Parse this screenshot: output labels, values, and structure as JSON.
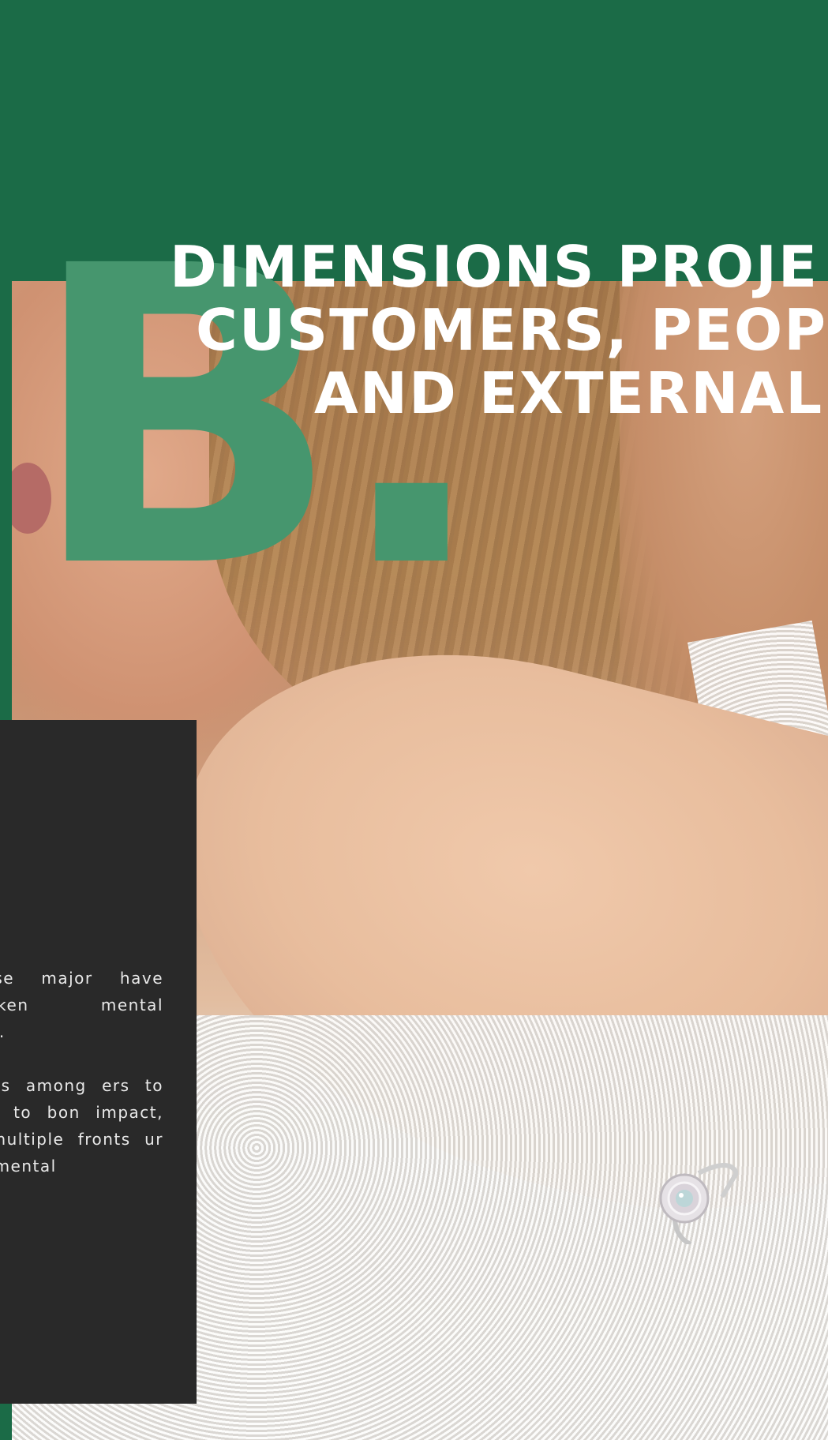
{
  "section": {
    "letter": "B.",
    "headline_lines": [
      "DIMENSIONS PROJE",
      "CUSTOMERS, PEOP",
      "AND EXTERNAL"
    ]
  },
  "panel": {
    "paragraphs": [
      "o these major have undertaken mental projects.",
      "wareness among ers to wanting to bon impact, we n multiple fronts ur environmental"
    ]
  },
  "colors": {
    "background": "#1b6b47",
    "accent_letter": "#46966e",
    "panel": "#292929",
    "headline": "#ffffff"
  },
  "photo": {
    "subject": "woman-hand-with-diamond-ring"
  }
}
